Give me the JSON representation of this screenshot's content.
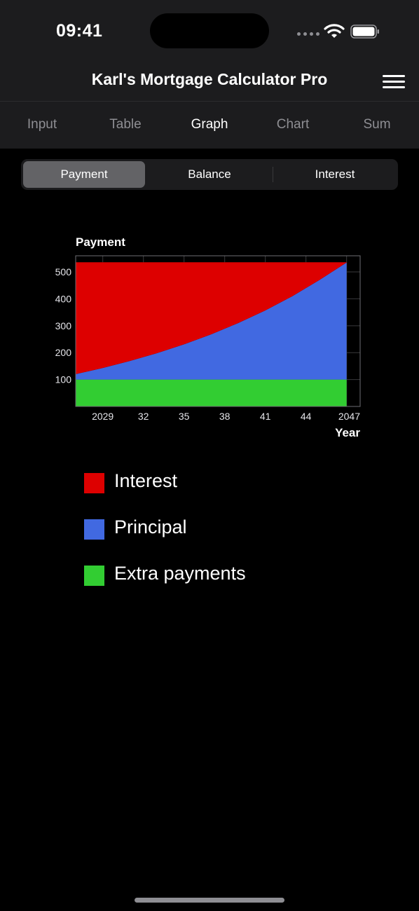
{
  "status_bar": {
    "time": "09:41",
    "icons": [
      "signal-dots-icon",
      "wifi-icon",
      "battery-icon"
    ]
  },
  "nav": {
    "title": "Karl's Mortgage Calculator Pro",
    "menu_icon": "hamburger-menu-icon"
  },
  "tabs": [
    {
      "label": "Input",
      "active": false
    },
    {
      "label": "Table",
      "active": false
    },
    {
      "label": "Graph",
      "active": true
    },
    {
      "label": "Chart",
      "active": false
    },
    {
      "label": "Sum",
      "active": false
    }
  ],
  "segmented": {
    "options": [
      "Payment",
      "Balance",
      "Interest"
    ],
    "selected": "Payment"
  },
  "chart_data": {
    "type": "area",
    "title": "Payment",
    "xlabel": "Year",
    "ylabel": "",
    "x_range": [
      2027,
      2048
    ],
    "ylim": [
      0,
      560
    ],
    "y_ticks": [
      100,
      200,
      300,
      400,
      500
    ],
    "x_ticks": [
      {
        "value": 2029,
        "label": "2029"
      },
      {
        "value": 2032,
        "label": "32"
      },
      {
        "value": 2035,
        "label": "35"
      },
      {
        "value": 2038,
        "label": "38"
      },
      {
        "value": 2041,
        "label": "41"
      },
      {
        "value": 2044,
        "label": "44"
      },
      {
        "value": 2047,
        "label": "2047"
      }
    ],
    "grid": true,
    "stacked_order": [
      "Extra payments",
      "Principal",
      "Interest"
    ],
    "x": [
      2027,
      2029,
      2031,
      2033,
      2035,
      2037,
      2039,
      2041,
      2043,
      2045,
      2047
    ],
    "series": [
      {
        "name": "Extra payments",
        "color": "#32cd32",
        "values": [
          100,
          100,
          100,
          100,
          100,
          100,
          100,
          100,
          100,
          100,
          100
        ]
      },
      {
        "name": "Principal",
        "color": "#4169e1",
        "values": [
          20,
          43,
          69,
          98,
          131,
          168,
          210,
          257,
          310,
          370,
          435
        ]
      },
      {
        "name": "Interest",
        "color": "#dd0000",
        "values": [
          415,
          392,
          366,
          337,
          304,
          267,
          225,
          178,
          125,
          65,
          0
        ]
      }
    ]
  },
  "legend": [
    {
      "label": "Interest",
      "color": "#dd0000"
    },
    {
      "label": "Principal",
      "color": "#4169e1"
    },
    {
      "label": "Extra payments",
      "color": "#32cd32"
    }
  ]
}
